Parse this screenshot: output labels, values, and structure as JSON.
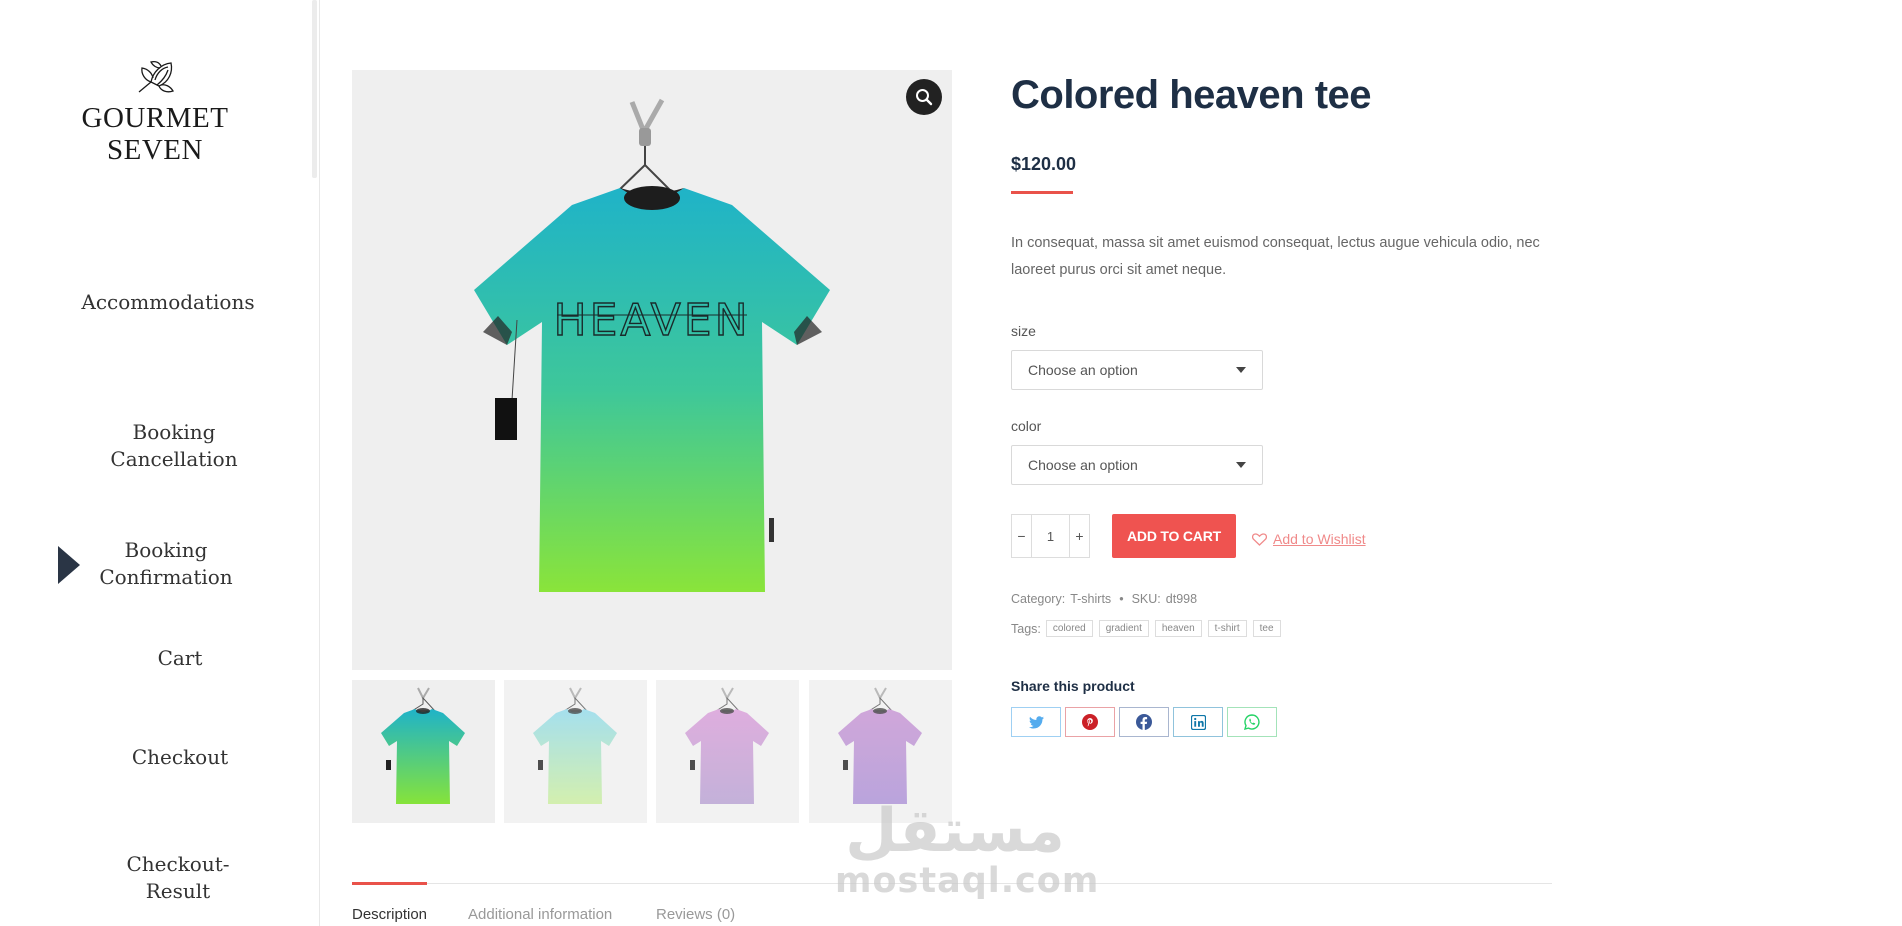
{
  "sidebar": {
    "brand_line1": "GOURMET",
    "brand_line2": "SEVEN",
    "logo_icon": "artichoke-icon",
    "nav": [
      {
        "line1": "Accommodations",
        "line2": ""
      },
      {
        "line1": "Booking",
        "line2": "Cancellation"
      },
      {
        "line1": "Booking",
        "line2": "Confirmation"
      },
      {
        "line1": "Cart",
        "line2": ""
      },
      {
        "line1": "Checkout",
        "line2": ""
      },
      {
        "line1": "Checkout-",
        "line2": "Result"
      }
    ],
    "active_index": 2
  },
  "product": {
    "title": "Colored heaven tee",
    "price": "$120.00",
    "description": "In consequat, massa sit amet euismod consequat, lectus augue vehicula odio, nec laoreet purus orci sit amet neque.",
    "image_print_text": "HEAVEN",
    "attributes": [
      {
        "label": "size",
        "placeholder": "Choose an option"
      },
      {
        "label": "color",
        "placeholder": "Choose an option"
      }
    ],
    "quantity": "1",
    "qty_minus": "−",
    "qty_plus": "+",
    "add_to_cart": "ADD TO CART",
    "wishlist": "Add to Wishlist",
    "category_label": "Category:",
    "category": "T-shirts",
    "bullet": "•",
    "sku_label": "SKU:",
    "sku": "dt998",
    "tags_label": "Tags:",
    "tags": [
      "colored",
      "gradient",
      "heaven",
      "t-shirt",
      "tee"
    ],
    "share_title": "Share this product",
    "share": [
      {
        "network": "twitter",
        "icon": "twitter-icon",
        "color": "#55acee"
      },
      {
        "network": "pinterest",
        "icon": "pinterest-icon",
        "color": "#cb2027"
      },
      {
        "network": "facebook",
        "icon": "facebook-icon",
        "color": "#3b5998"
      },
      {
        "network": "linkedin",
        "icon": "linkedin-icon",
        "color": "#0e76a8"
      },
      {
        "network": "whatsapp",
        "icon": "whatsapp-icon",
        "color": "#25d366"
      }
    ],
    "thumbnails": [
      {
        "colors": [
          "#1fb3c8",
          "#86e33a"
        ]
      },
      {
        "colors": [
          "#8fd8ea",
          "#c9ec9b"
        ]
      },
      {
        "colors": [
          "#d79bd6",
          "#b59ed0"
        ]
      },
      {
        "colors": [
          "#c591d1",
          "#a98ed4"
        ]
      }
    ]
  },
  "tabs": [
    "Description",
    "Additional information",
    "Reviews (0)"
  ],
  "watermark": {
    "arabic": "مستقل",
    "latin": "mostaql.com"
  },
  "colors": {
    "accent": "#ef5350",
    "heading": "#1e2f45"
  }
}
